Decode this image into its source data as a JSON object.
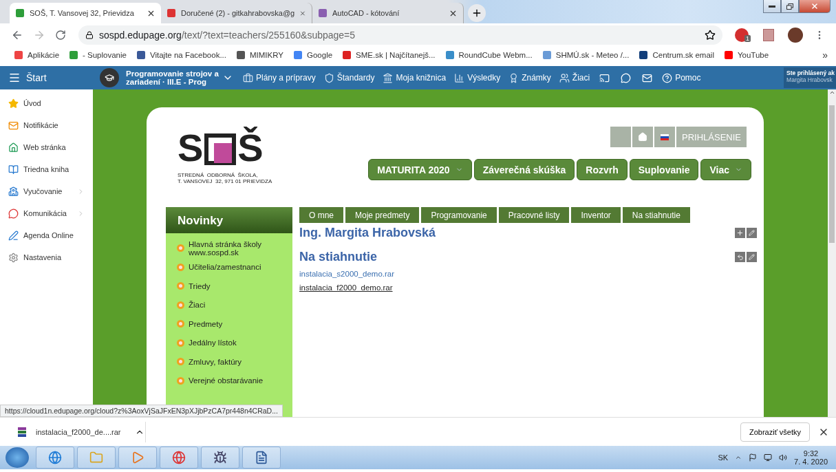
{
  "browser": {
    "tabs": [
      {
        "title": "SOŠ, T. Vansovej 32, Prievidza",
        "selected": true
      },
      {
        "title": "Doručené (2) - gitkahrabovska@g",
        "selected": false
      },
      {
        "title": "AutoCAD - kótování",
        "selected": false
      }
    ],
    "url_host": "sospd.edupage.org",
    "url_path": "/text/?text=teachers/255160&subpage=5",
    "extension_badge": "1",
    "bookmarks": [
      "Aplikácie",
      "- Suplovanie",
      "Vitajte na Facebook...",
      "MIMIKRY",
      "Google",
      "SME.sk | Najčítanejš...",
      "RoundCube Webm...",
      "SHMÚ.sk - Meteo /...",
      "Centrum.sk email",
      "YouTube"
    ],
    "bookmarks_overflow": "»"
  },
  "topnav": {
    "start": "Štart",
    "course": "Programovanie strojov a zariadení · III.E - Prog",
    "items": [
      "Plány a prípravy",
      "Štandardy",
      "Moja knižnica",
      "Výsledky",
      "Známky",
      "Žiaci"
    ],
    "help": "Pomoc",
    "user_line": "Ste prihlásený ak",
    "user_name": "Margita Hrabovsk"
  },
  "sidebar": [
    {
      "label": "Úvod",
      "submenu": false
    },
    {
      "label": "Notifikácie",
      "submenu": false
    },
    {
      "label": "Web stránka",
      "submenu": false
    },
    {
      "label": "Triedna kniha",
      "submenu": false
    },
    {
      "label": "Vyučovanie",
      "submenu": true
    },
    {
      "label": "Komunikácia",
      "submenu": true
    },
    {
      "label": "Agenda Online",
      "submenu": false
    },
    {
      "label": "Nastavenia",
      "submenu": false
    }
  ],
  "site": {
    "logo_letters": [
      "S",
      "Š"
    ],
    "logo_line1": "STREDNÁ  ODBORNÁ  ŠKOLA,",
    "logo_line2": "T. VANSOVEJ  32, 971 01 PRIEVIDZA",
    "login": "PRIHLÁSENIE",
    "menu": [
      {
        "label": "MATURITA 2020",
        "dropdown": true
      },
      {
        "label": "Záverečná skúška",
        "dropdown": false
      },
      {
        "label": "Rozvrh",
        "dropdown": false
      },
      {
        "label": "Suplovanie",
        "dropdown": false
      },
      {
        "label": "Viac",
        "dropdown": true
      }
    ],
    "news_title": "Novinky",
    "news": [
      "Hlavná stránka školy www.sospd.sk",
      "Učitelia/zamestnanci",
      "Triedy",
      "Žiaci",
      "Predmety",
      "Jedálny lístok",
      "Zmluvy, faktúry",
      "Verejné obstarávanie"
    ],
    "tabs": [
      "O mne",
      "Moje predmety",
      "Programovanie",
      "Pracovné listy",
      "Inventor",
      "Na stiahnutie"
    ],
    "teacher": "Ing. Margita Hrabovská",
    "section": "Na stiahnutie",
    "files": [
      {
        "name": "instalacia_s2000_demo.rar",
        "hovered": false
      },
      {
        "name": "instalacia_f2000_demo.rar",
        "hovered": true
      }
    ]
  },
  "status_url": "https://cloud1n.edupage.org/cloud?z%3AoxVjSaJFxEN3pXJjbPzCA7pr448n4CRaD...",
  "downloads": {
    "file": "instalacia_f2000_de....rar",
    "show_all": "Zobraziť všetky"
  },
  "taskbar": {
    "language": "SK",
    "time": "9:32",
    "date": "7. 4. 2020"
  }
}
